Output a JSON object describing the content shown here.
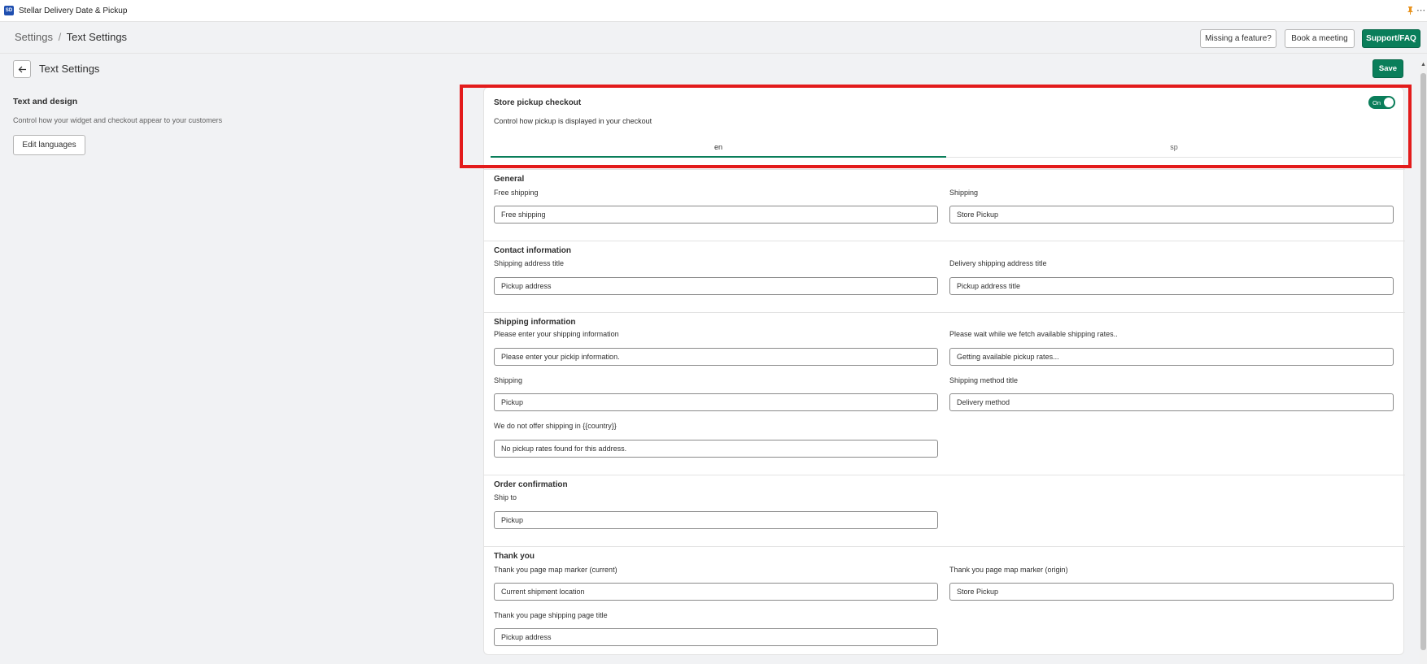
{
  "app": {
    "name": "Stellar Delivery Date & Pickup",
    "logo_text": "SD"
  },
  "header": {
    "breadcrumb_parent": "Settings",
    "breadcrumb_sep": "/",
    "breadcrumb_current": "Text Settings",
    "missing_feature": "Missing a feature?",
    "book_meeting": "Book a meeting",
    "support": "Support/FAQ"
  },
  "page": {
    "title": "Text Settings",
    "save": "Save"
  },
  "sidebar": {
    "title": "Text and design",
    "description": "Control how your widget and checkout appear to your customers",
    "edit_languages": "Edit languages"
  },
  "card": {
    "title": "Store pickup checkout",
    "description": "Control how pickup is displayed in your checkout",
    "toggle_label": "On",
    "tabs": [
      {
        "label": "en"
      },
      {
        "label": "sp"
      }
    ]
  },
  "sections": {
    "general": {
      "title": "General",
      "free_shipping_label": "Free shipping",
      "free_shipping_value": "Free shipping",
      "shipping_label": "Shipping",
      "shipping_value": "Store Pickup"
    },
    "contact": {
      "title": "Contact information",
      "shipping_address_title_label": "Shipping address title",
      "shipping_address_title_value": "Pickup address",
      "delivery_shipping_address_title_label": "Delivery shipping address title",
      "delivery_shipping_address_title_value": "Pickup address title"
    },
    "shipping_info": {
      "title": "Shipping information",
      "enter_info_label": "Please enter your shipping information",
      "enter_info_value": "Please enter your pickip information.",
      "wait_label": "Please wait while we fetch available shipping rates..",
      "wait_value": "Getting available pickup rates...",
      "shipping_label": "Shipping",
      "shipping_value": "Pickup",
      "method_title_label": "Shipping method title",
      "method_title_value": "Delivery method",
      "no_offer_label": "We do not offer shipping in {{country}}",
      "no_offer_value": "No pickup rates found for this address."
    },
    "order_confirmation": {
      "title": "Order confirmation",
      "ship_to_label": "Ship to",
      "ship_to_value": "Pickup"
    },
    "thank_you": {
      "title": "Thank you",
      "marker_current_label": "Thank you page map marker (current)",
      "marker_current_value": "Current shipment location",
      "marker_origin_label": "Thank you page map marker (origin)",
      "marker_origin_value": "Store Pickup",
      "page_title_label": "Thank you page shipping page title",
      "page_title_value": "Pickup address"
    }
  },
  "colors": {
    "accent": "#0a7e5a",
    "highlight": "#e31b1b",
    "background": "#f1f2f4"
  }
}
